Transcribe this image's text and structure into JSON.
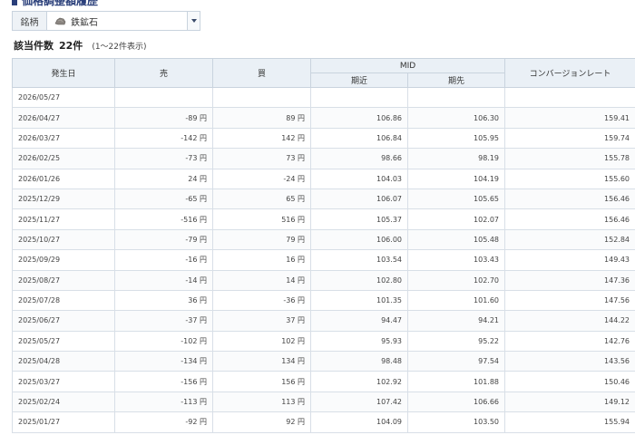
{
  "section": {
    "title": "価格調整額履歴"
  },
  "selector": {
    "label": "銘柄",
    "value": "鉄鉱石"
  },
  "count": {
    "label": "該当件数",
    "value": "22件",
    "note": "(1～22件表示)"
  },
  "table": {
    "headers": {
      "date": "発生日",
      "sell": "売",
      "buy": "買",
      "mid": "MID",
      "near": "期近",
      "far": "期先",
      "rate": "コンバージョンレート"
    },
    "rows": [
      {
        "date": "2026/05/27",
        "sell": "",
        "buy": "",
        "near": "",
        "far": "",
        "rate": ""
      },
      {
        "date": "2026/04/27",
        "sell": "-89 円",
        "buy": "89 円",
        "near": "106.86",
        "far": "106.30",
        "rate": "159.41"
      },
      {
        "date": "2026/03/27",
        "sell": "-142 円",
        "buy": "142 円",
        "near": "106.84",
        "far": "105.95",
        "rate": "159.74"
      },
      {
        "date": "2026/02/25",
        "sell": "-73 円",
        "buy": "73 円",
        "near": "98.66",
        "far": "98.19",
        "rate": "155.78"
      },
      {
        "date": "2026/01/26",
        "sell": "24 円",
        "buy": "-24 円",
        "near": "104.03",
        "far": "104.19",
        "rate": "155.60"
      },
      {
        "date": "2025/12/29",
        "sell": "-65 円",
        "buy": "65 円",
        "near": "106.07",
        "far": "105.65",
        "rate": "156.46"
      },
      {
        "date": "2025/11/27",
        "sell": "-516 円",
        "buy": "516 円",
        "near": "105.37",
        "far": "102.07",
        "rate": "156.46"
      },
      {
        "date": "2025/10/27",
        "sell": "-79 円",
        "buy": "79 円",
        "near": "106.00",
        "far": "105.48",
        "rate": "152.84"
      },
      {
        "date": "2025/09/29",
        "sell": "-16 円",
        "buy": "16 円",
        "near": "103.54",
        "far": "103.43",
        "rate": "149.43"
      },
      {
        "date": "2025/08/27",
        "sell": "-14 円",
        "buy": "14 円",
        "near": "102.80",
        "far": "102.70",
        "rate": "147.36"
      },
      {
        "date": "2025/07/28",
        "sell": "36 円",
        "buy": "-36 円",
        "near": "101.35",
        "far": "101.60",
        "rate": "147.56"
      },
      {
        "date": "2025/06/27",
        "sell": "-37 円",
        "buy": "37 円",
        "near": "94.47",
        "far": "94.21",
        "rate": "144.22"
      },
      {
        "date": "2025/05/27",
        "sell": "-102 円",
        "buy": "102 円",
        "near": "95.93",
        "far": "95.22",
        "rate": "142.76"
      },
      {
        "date": "2025/04/28",
        "sell": "-134 円",
        "buy": "134 円",
        "near": "98.48",
        "far": "97.54",
        "rate": "143.56"
      },
      {
        "date": "2025/03/27",
        "sell": "-156 円",
        "buy": "156 円",
        "near": "102.92",
        "far": "101.88",
        "rate": "150.46"
      },
      {
        "date": "2025/02/24",
        "sell": "-113 円",
        "buy": "113 円",
        "near": "107.42",
        "far": "106.66",
        "rate": "149.12"
      },
      {
        "date": "2025/01/27",
        "sell": "-92 円",
        "buy": "92 円",
        "near": "104.09",
        "far": "103.50",
        "rate": "155.94"
      }
    ]
  },
  "colors": {
    "accent": "#2a3f7a",
    "header_bg": "#eaf0f6",
    "border": "#c9d3de"
  }
}
